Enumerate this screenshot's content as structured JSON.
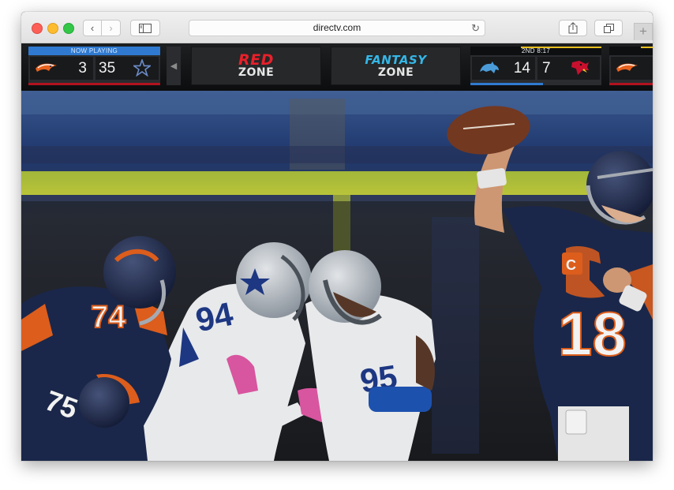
{
  "browser": {
    "url": "directv.com",
    "back_glyph": "‹",
    "forward_glyph": "›",
    "reload_glyph": "↻",
    "new_tab_glyph": "+"
  },
  "scorebar": {
    "now_playing": {
      "label": "NOW PLAYING",
      "away_score": "3",
      "home_score": "35",
      "away_team_icon": "broncos-logo-icon",
      "home_team_icon": "cowboys-star-icon"
    },
    "prev_glyph": "◀",
    "red_zone": {
      "top": "RED",
      "bottom": "ZONE"
    },
    "fantasy_zone": {
      "top": "FANTASY",
      "bottom": "ZONE"
    },
    "game2": {
      "label": "2ND  8:17",
      "away_score": "14",
      "home_score": "7",
      "away_team_icon": "lions-logo-icon",
      "home_team_icon": "cardinals-logo-icon"
    },
    "game3": {
      "team_icon": "broncos-logo-icon"
    }
  },
  "photo": {
    "description_icon": "football-action-photo",
    "jersey_numbers": [
      "74",
      "75",
      "94",
      "95",
      "18"
    ],
    "colors": {
      "broncos_navy": "#1c2a4e",
      "broncos_orange": "#e8621e",
      "cowboys_silver": "#c8cdd2",
      "goalpost_yellow": "#c9d82c"
    }
  }
}
